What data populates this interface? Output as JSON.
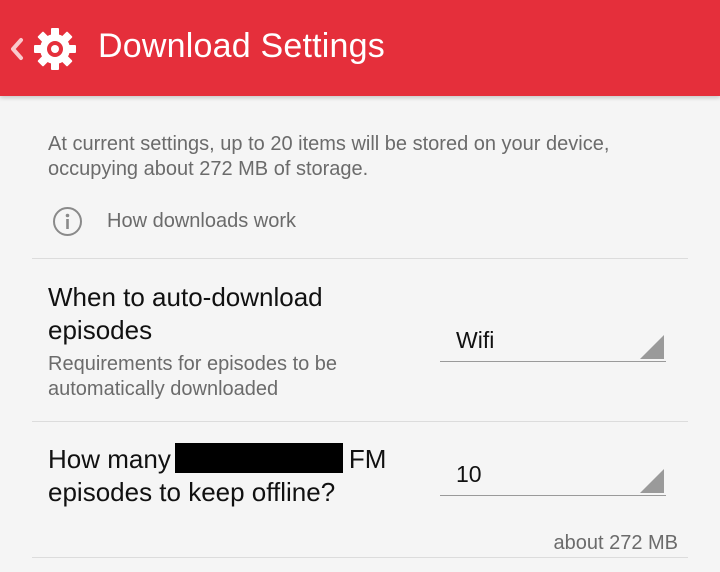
{
  "app_bar": {
    "title": "Download Settings",
    "background_color": "#e52f3b",
    "up_icon": "chevron-left-icon",
    "settings_icon": "gear-icon"
  },
  "summary": {
    "text": "At current settings, up to 20 items will be stored on your device, occupying about 272 MB of storage."
  },
  "how_downloads_work": {
    "label": "How downloads work",
    "icon": "info-icon"
  },
  "settings": [
    {
      "title": "When to auto-download episodes",
      "description": "Requirements for episodes to be automatically downloaded",
      "value": "Wifi"
    },
    {
      "title_prefix": "How many",
      "title_suffix": "FM",
      "title_line2": "episodes to keep offline?",
      "value": "10",
      "size_note": "about 272 MB"
    }
  ]
}
